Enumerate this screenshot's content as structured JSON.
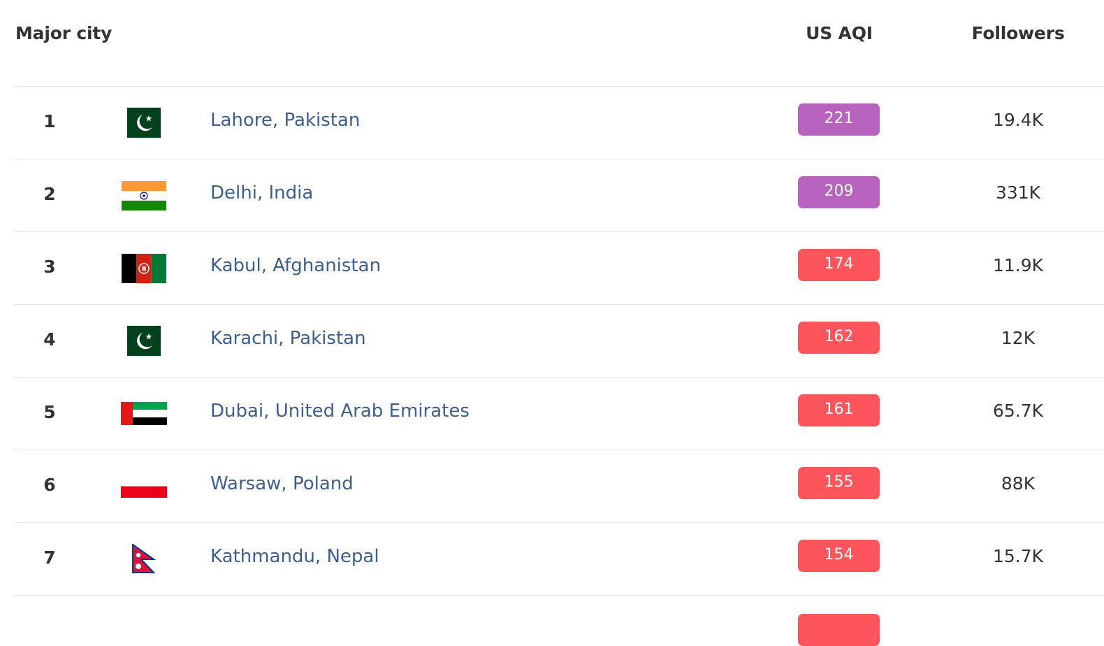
{
  "header": {
    "city": "Major city",
    "aqi": "US AQI",
    "followers": "Followers"
  },
  "colors": {
    "very_unhealthy": "#b863be",
    "unhealthy": "#fe545c",
    "link": "#3b5f92",
    "text": "#333333",
    "divider": "#e6e6e6"
  },
  "rows": [
    {
      "rank": "1",
      "flag": "pakistan-flag",
      "city": "Lahore, Pakistan",
      "aqi": "221",
      "level": "very_unhealthy",
      "followers": "19.4K"
    },
    {
      "rank": "2",
      "flag": "india-flag",
      "city": "Delhi, India",
      "aqi": "209",
      "level": "very_unhealthy",
      "followers": "331K"
    },
    {
      "rank": "3",
      "flag": "afghanistan-flag",
      "city": "Kabul, Afghanistan",
      "aqi": "174",
      "level": "unhealthy",
      "followers": "11.9K"
    },
    {
      "rank": "4",
      "flag": "pakistan-flag",
      "city": "Karachi, Pakistan",
      "aqi": "162",
      "level": "unhealthy",
      "followers": "12K"
    },
    {
      "rank": "5",
      "flag": "uae-flag",
      "city": "Dubai, United Arab Emirates",
      "aqi": "161",
      "level": "unhealthy",
      "followers": "65.7K"
    },
    {
      "rank": "6",
      "flag": "poland-flag",
      "city": "Warsaw, Poland",
      "aqi": "155",
      "level": "unhealthy",
      "followers": "88K"
    },
    {
      "rank": "7",
      "flag": "nepal-flag",
      "city": "Kathmandu, Nepal",
      "aqi": "154",
      "level": "unhealthy",
      "followers": "15.7K"
    }
  ]
}
